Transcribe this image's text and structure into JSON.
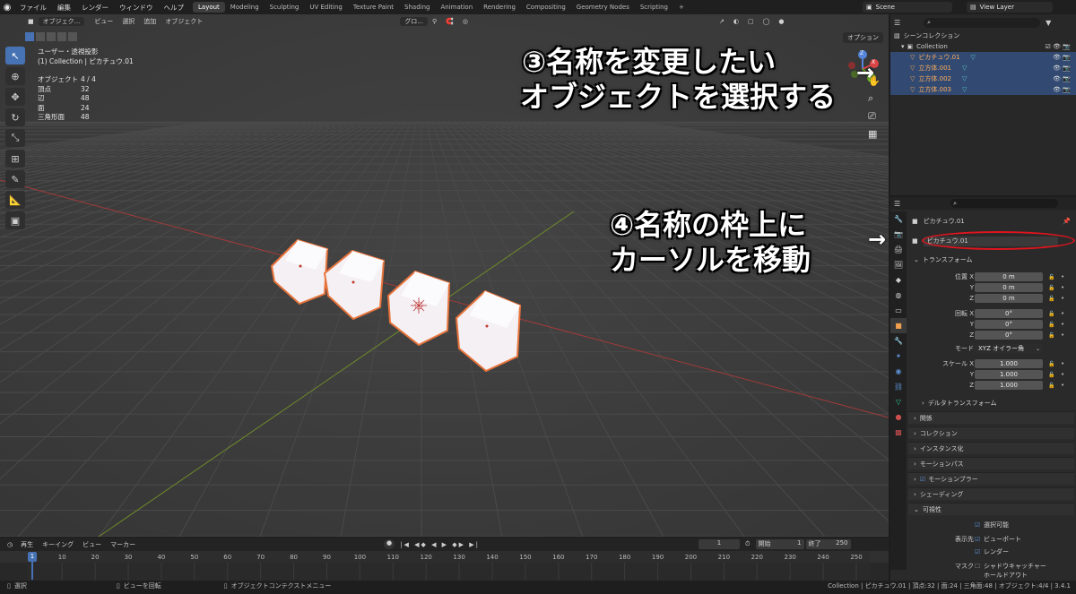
{
  "app": {
    "logo": "blender-logo-icon"
  },
  "menus": [
    "ファイル",
    "編集",
    "レンダー",
    "ウィンドウ",
    "ヘルプ"
  ],
  "workspaces": [
    {
      "label": "Layout",
      "active": true
    },
    {
      "label": "Modeling"
    },
    {
      "label": "Sculpting"
    },
    {
      "label": "UV Editing"
    },
    {
      "label": "Texture Paint"
    },
    {
      "label": "Shading"
    },
    {
      "label": "Animation"
    },
    {
      "label": "Rendering"
    },
    {
      "label": "Compositing"
    },
    {
      "label": "Geometry Nodes"
    },
    {
      "label": "Scripting"
    }
  ],
  "add_workspace": "+",
  "scene": {
    "label": "Scene"
  },
  "view_layer": {
    "label": "View Layer"
  },
  "viewport": {
    "mode": "オブジェク...",
    "menus": [
      "ビュー",
      "選択",
      "追加",
      "オブジェクト"
    ],
    "transform_orientation": "グロ...",
    "options": "オプション",
    "overlay_title": "ユーザー・透視投影",
    "overlay_subtitle": "(1) Collection | ピカチュウ.01",
    "stats": [
      {
        "k": "オブジェクト",
        "v": "4 / 4"
      },
      {
        "k": "頂点",
        "v": "32"
      },
      {
        "k": "辺",
        "v": "48"
      },
      {
        "k": "面",
        "v": "24"
      },
      {
        "k": "三角形面",
        "v": "48"
      }
    ],
    "gizmo": {
      "x": "X",
      "y": "Y",
      "z": "Z"
    }
  },
  "annotations": {
    "step3_line1": "③名称を変更したい",
    "step3_line2": "オブジェクトを選択する",
    "step4_line1": "④名称の枠上に",
    "step4_line2": "カーソルを移動",
    "arrow": "→"
  },
  "outliner": {
    "search_placeholder": "",
    "root": "シーンコレクション",
    "collection": "Collection",
    "items": [
      {
        "label": "ピカチュウ.01",
        "selected": true
      },
      {
        "label": "立方体.001",
        "selected": true
      },
      {
        "label": "立方体.002",
        "selected": true
      },
      {
        "label": "立方体.003",
        "selected": true
      }
    ]
  },
  "properties": {
    "object_label": "ピカチュウ.01",
    "name_field": "ピカチュウ.01",
    "transform_title": "トランスフォーム",
    "location_label": "位置 X",
    "rotation_label": "回転 X",
    "scale_label": "スケール X",
    "axis_y": "Y",
    "axis_z": "Z",
    "location": [
      "0 m",
      "0 m",
      "0 m"
    ],
    "rotation": [
      "0°",
      "0°",
      "0°"
    ],
    "mode_label": "モード",
    "mode_value": "XYZ オイラー角",
    "scale": [
      "1.000",
      "1.000",
      "1.000"
    ],
    "delta_transform": "デルタトランスフォーム",
    "sections": [
      "関係",
      "コレクション",
      "インスタンス化",
      "モーションパス",
      "モーションブラー",
      "シェーディング",
      "可視性"
    ],
    "visibility": {
      "selectable": "選択可能",
      "show_in_label": "表示先",
      "viewport": "ビューポート",
      "render": "レンダー",
      "mask_label": "マスク",
      "shadow_catcher": "シャドウキャッチャー",
      "holdout": "ホールドアウト"
    }
  },
  "timeline": {
    "playback": "再生",
    "keying": "キーイング",
    "view": "ビュー",
    "marker": "マーカー",
    "current_frame": "1",
    "start_label": "開始",
    "start": "1",
    "end_label": "終了",
    "end": "250",
    "ticks": [
      "1",
      "10",
      "20",
      "30",
      "40",
      "50",
      "60",
      "70",
      "80",
      "90",
      "100",
      "110",
      "120",
      "130",
      "140",
      "150",
      "160",
      "170",
      "180",
      "190",
      "200",
      "210",
      "220",
      "230",
      "240",
      "250"
    ]
  },
  "status": {
    "select": "選択",
    "rotate_view": "ビューを回転",
    "context_menu": "オブジェクトコンテクストメニュー",
    "info": "Collection | ピカチュウ.01 | 頂点:32 | 面:24 | 三角面:48 | オブジェクト:4/4 | 3.4.1"
  },
  "colors": {
    "accent": "#4772b3",
    "selection_outline": "#e8743b",
    "name_circle": "#e0141e"
  }
}
